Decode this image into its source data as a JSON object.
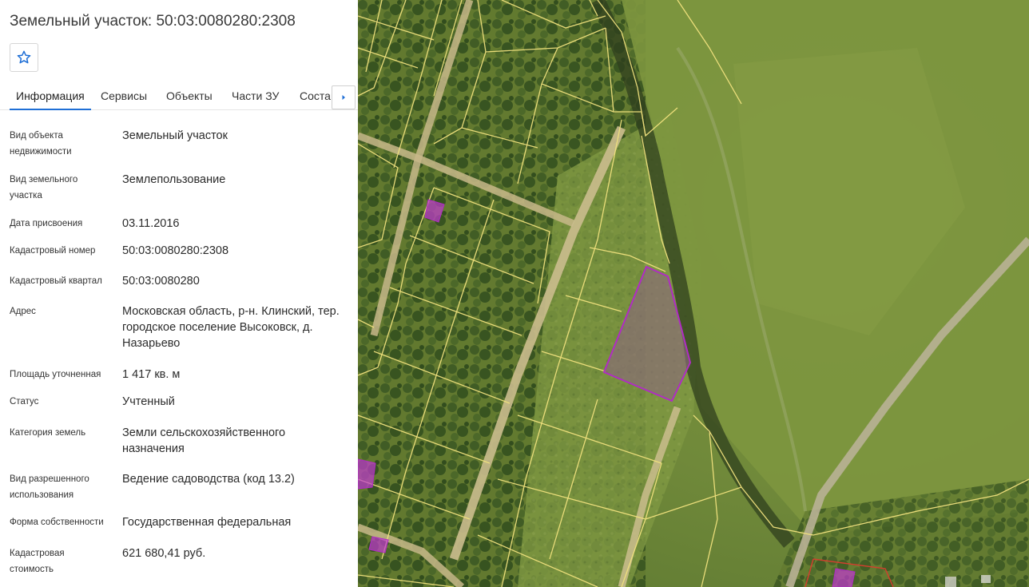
{
  "header": {
    "title": "Земельный участок: 50:03:0080280:2308"
  },
  "favorite": {
    "icon": "star-outline-icon"
  },
  "tabs": [
    {
      "label": "Информация",
      "active": true
    },
    {
      "label": "Сервисы",
      "active": false
    },
    {
      "label": "Объекты",
      "active": false
    },
    {
      "label": "Части ЗУ",
      "active": false
    },
    {
      "label": "Состав",
      "active": false
    }
  ],
  "tab_scroll": {
    "icon": "chevron-right-icon"
  },
  "info": {
    "object_type": {
      "label": "Вид объекта недвижимости",
      "value": "Земельный участок"
    },
    "land_type": {
      "label": "Вид земельного участка",
      "value": "Землепользование"
    },
    "date": {
      "label": "Дата присвоения",
      "value": "03.11.2016"
    },
    "cad_number": {
      "label": "Кадастровый номер",
      "value": "50:03:0080280:2308"
    },
    "cad_quarter": {
      "label": "Кадастровый квартал",
      "value": "50:03:0080280"
    },
    "address": {
      "label": "Адрес",
      "value": "Московская область, р-н. Клинский, тер. городское поселение Высоковск, д. Назарьево"
    },
    "area": {
      "label": "Площадь уточненная",
      "value": "1 417 кв. м"
    },
    "status": {
      "label": "Статус",
      "value": "Учтенный"
    },
    "category": {
      "label": "Категория земель",
      "value": "Земли сельскохозяйственного назначения"
    },
    "permitted_use": {
      "label": "Вид разрешенного использования",
      "value": "Ведение садоводства (код 13.2)"
    },
    "ownership": {
      "label": "Форма собственности",
      "value": "Государственная федеральная"
    },
    "cad_value": {
      "label": "Кадастровая стоимость",
      "value": "621 680,41 руб."
    }
  },
  "colors": {
    "accent": "#1f6fd6",
    "parcel_outline": "#f3e58a",
    "selected_parcel": "#b02cc4",
    "highlight_fill": "#c23bd0"
  }
}
